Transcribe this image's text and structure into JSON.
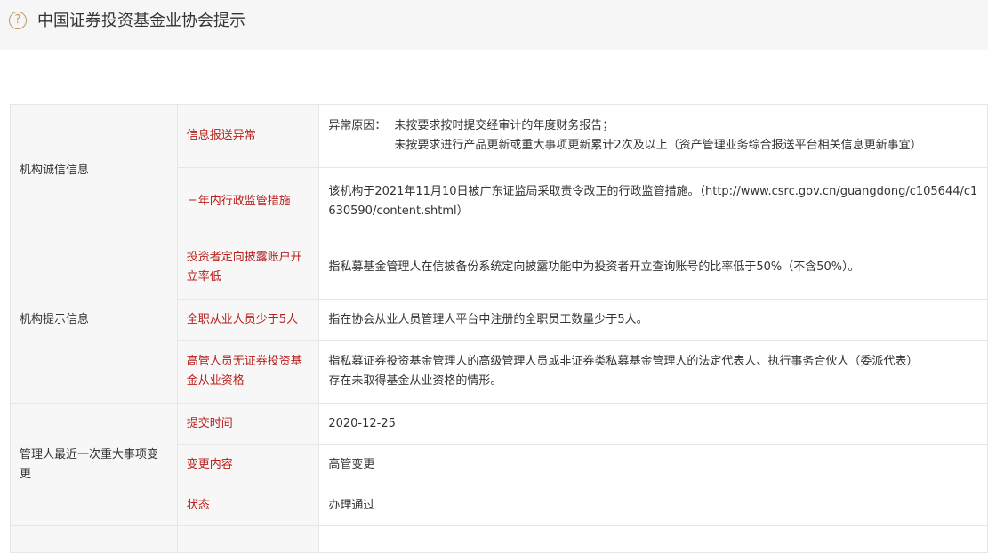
{
  "header": {
    "help_icon": "?",
    "title": "中国证券投资基金业协会提示"
  },
  "sections": {
    "integrity": {
      "title": "机构诚信信息",
      "info_abnormal": {
        "label": "信息报送异常",
        "reason_label": "异常原因：",
        "reason_1": "未按要求按时提交经审计的年度财务报告；",
        "reason_2": "未按要求进行产品更新或重大事项更新累计2次及以上（资产管理业务综合报送平台相关信息更新事宜）"
      },
      "admin_measures": {
        "label": "三年内行政监管措施",
        "text": "该机构于2021年11月10日被广东证监局采取责令改正的行政监管措施。（http://www.csrc.gov.cn/guangdong/c105644/c1630590/content.shtml）"
      }
    },
    "tips": {
      "title": "机构提示信息",
      "disclosure": {
        "label": "投资者定向披露账户开立率低",
        "text": "指私募基金管理人在信披备份系统定向披露功能中为投资者开立查询账号的比率低于50%（不含50%）。"
      },
      "staff": {
        "label": "全职从业人员少于5人",
        "text": "指在协会从业人员管理人平台中注册的全职员工数量少于5人。"
      },
      "executives": {
        "label": "高管人员无证券投资基金从业资格",
        "text_1": "指私募证券投资基金管理人的高级管理人员或非证券类私募基金管理人的法定代表人、执行事务合伙人（委派代表）",
        "text_2": "存在未取得基金从业资格的情形。"
      }
    },
    "recent_change": {
      "title": "管理人最近一次重大事项变更",
      "submit_time": {
        "label": "提交时间",
        "value": "2020-12-25"
      },
      "change_content": {
        "label": "变更内容",
        "value": "高管变更"
      },
      "status": {
        "label": "状态",
        "value": "办理通过"
      }
    }
  }
}
